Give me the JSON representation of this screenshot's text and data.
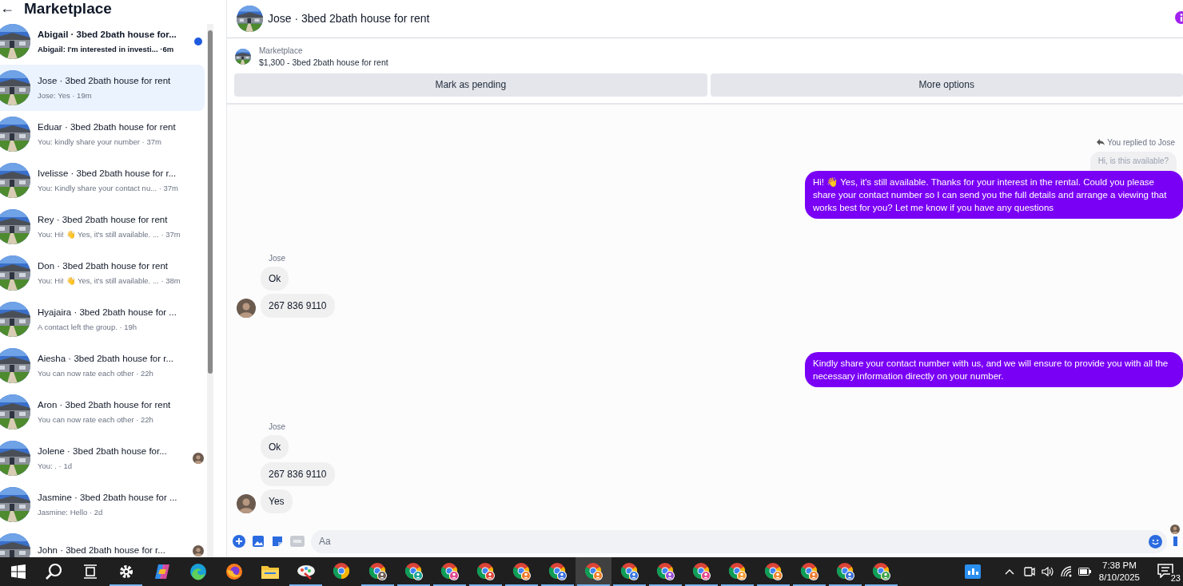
{
  "sidebar": {
    "title": "Marketplace",
    "back": "←",
    "items": [
      {
        "title": "Abigail · 3bed 2bath house for...",
        "subtitle": "Abigail: I'm interested in investi... ·6m",
        "unread": true,
        "selected": false,
        "seen": false
      },
      {
        "title": "Jose · 3bed 2bath house for rent",
        "subtitle": "Jose: Yes · 19m",
        "unread": false,
        "selected": true,
        "seen": false
      },
      {
        "title": "Eduar · 3bed 2bath house for rent",
        "subtitle": "You: kindly share your number · 37m",
        "unread": false,
        "selected": false,
        "seen": false
      },
      {
        "title": "Ivelisse · 3bed 2bath house for r...",
        "subtitle": "You: Kindly share your contact nu... · 37m",
        "unread": false,
        "selected": false,
        "seen": false
      },
      {
        "title": "Rey · 3bed 2bath house for rent",
        "subtitle": "You: Hi! 👋 Yes, it's still available. ... · 37m",
        "unread": false,
        "selected": false,
        "seen": false
      },
      {
        "title": "Don · 3bed 2bath house for rent",
        "subtitle": "You: Hi! 👋 Yes, it's still available. ... · 38m",
        "unread": false,
        "selected": false,
        "seen": false
      },
      {
        "title": "Hyajaira · 3bed 2bath house for ...",
        "subtitle": "A contact left the group. · 19h",
        "unread": false,
        "selected": false,
        "seen": false
      },
      {
        "title": "Aiesha · 3bed 2bath house for r...",
        "subtitle": "You can now rate each other · 22h",
        "unread": false,
        "selected": false,
        "seen": false
      },
      {
        "title": "Aron · 3bed 2bath house for rent",
        "subtitle": "You can now rate each other · 22h",
        "unread": false,
        "selected": false,
        "seen": false
      },
      {
        "title": "Jolene · 3bed 2bath house for...",
        "subtitle": "You: . · 1d",
        "unread": false,
        "selected": false,
        "seen": true
      },
      {
        "title": "Jasmine · 3bed 2bath house for ...",
        "subtitle": "Jasmine: Hello · 2d",
        "unread": false,
        "selected": false,
        "seen": false
      },
      {
        "title": "John · 3bed 2bath house for r...",
        "unread": false,
        "selected": false,
        "seen": true
      }
    ]
  },
  "chat": {
    "title": "Jose · 3bed 2bath house for rent",
    "listing": {
      "label": "Marketplace",
      "text": "$1,300 - 3bed 2bath house for rent"
    },
    "actions": [
      "Mark as pending",
      "More options"
    ],
    "messages": [
      {
        "kind": "reply_note",
        "text": "You replied to Jose"
      },
      {
        "kind": "quoted",
        "text": "Hi, is this available?"
      },
      {
        "kind": "outgoing",
        "text": "Hi! 👋 Yes, it's still available. Thanks for your interest in the rental. Could you please share your contact number so I can send you the full details and arrange a viewing that works best for you? Let me know if you have any questions"
      },
      {
        "kind": "incoming",
        "sender": "Jose",
        "bubbles": [
          "Ok",
          "267 836 9110"
        ]
      },
      {
        "kind": "outgoing",
        "text": "Kindly share your contact number with us, and we will ensure to provide you with all the necessary information directly on your number."
      },
      {
        "kind": "incoming",
        "sender": "Jose",
        "bubbles": [
          "Ok",
          "267 836 9110",
          "Yes"
        ]
      },
      {
        "kind": "seen"
      }
    ],
    "composer": {
      "placeholder": "Aa"
    }
  },
  "taskbar": {
    "apps": [
      {
        "kind": "start",
        "running": false,
        "selected": false
      },
      {
        "kind": "search",
        "running": false,
        "selected": false
      },
      {
        "kind": "taskview",
        "running": false,
        "selected": false
      },
      {
        "kind": "settings",
        "running": true,
        "selected": false
      },
      {
        "kind": "copilot",
        "running": false,
        "selected": false
      },
      {
        "kind": "edge",
        "running": false,
        "selected": false
      },
      {
        "kind": "firefox",
        "running": false,
        "selected": false
      },
      {
        "kind": "files",
        "running": false,
        "selected": false
      },
      {
        "kind": "paint",
        "running": true,
        "selected": false
      },
      {
        "kind": "chrome",
        "running": false,
        "selected": false
      },
      {
        "kind": "chrome_profile",
        "color": "#6b5b53",
        "running": true,
        "selected": false
      },
      {
        "kind": "chrome_profile",
        "color": "#1aa39a",
        "running": true,
        "selected": false
      },
      {
        "kind": "chrome_profile",
        "color": "#e0468e",
        "running": true,
        "selected": false
      },
      {
        "kind": "chrome_profile",
        "color": "#e0453a",
        "running": true,
        "selected": false
      },
      {
        "kind": "chrome_profile",
        "color": "#f07a2a",
        "running": true,
        "selected": false
      },
      {
        "kind": "chrome_profile",
        "color": "#3b6fe0",
        "running": true,
        "selected": false
      },
      {
        "kind": "chrome_profile",
        "color": "#f0802a",
        "running": true,
        "selected": true
      },
      {
        "kind": "chrome_profile",
        "color": "#3a78e0",
        "running": true,
        "selected": false
      },
      {
        "kind": "chrome_profile",
        "color": "#9a4fd8",
        "running": true,
        "selected": false
      },
      {
        "kind": "chrome_profile",
        "color": "#e54a8c",
        "running": true,
        "selected": false
      },
      {
        "kind": "chrome_profile",
        "color": "#f39a2e",
        "running": true,
        "selected": false
      },
      {
        "kind": "chrome_profile",
        "color": "#f0862f",
        "running": true,
        "selected": false
      },
      {
        "kind": "chrome_profile",
        "color": "#ee7a30",
        "running": true,
        "selected": false
      },
      {
        "kind": "chrome_profile",
        "color": "#3a6fd8",
        "running": true,
        "selected": false
      },
      {
        "kind": "chrome_profile",
        "color": "#3fa34a",
        "running": true,
        "selected": false
      }
    ],
    "time": "7:38 PM",
    "date": "8/10/2025",
    "notifications": "23"
  }
}
